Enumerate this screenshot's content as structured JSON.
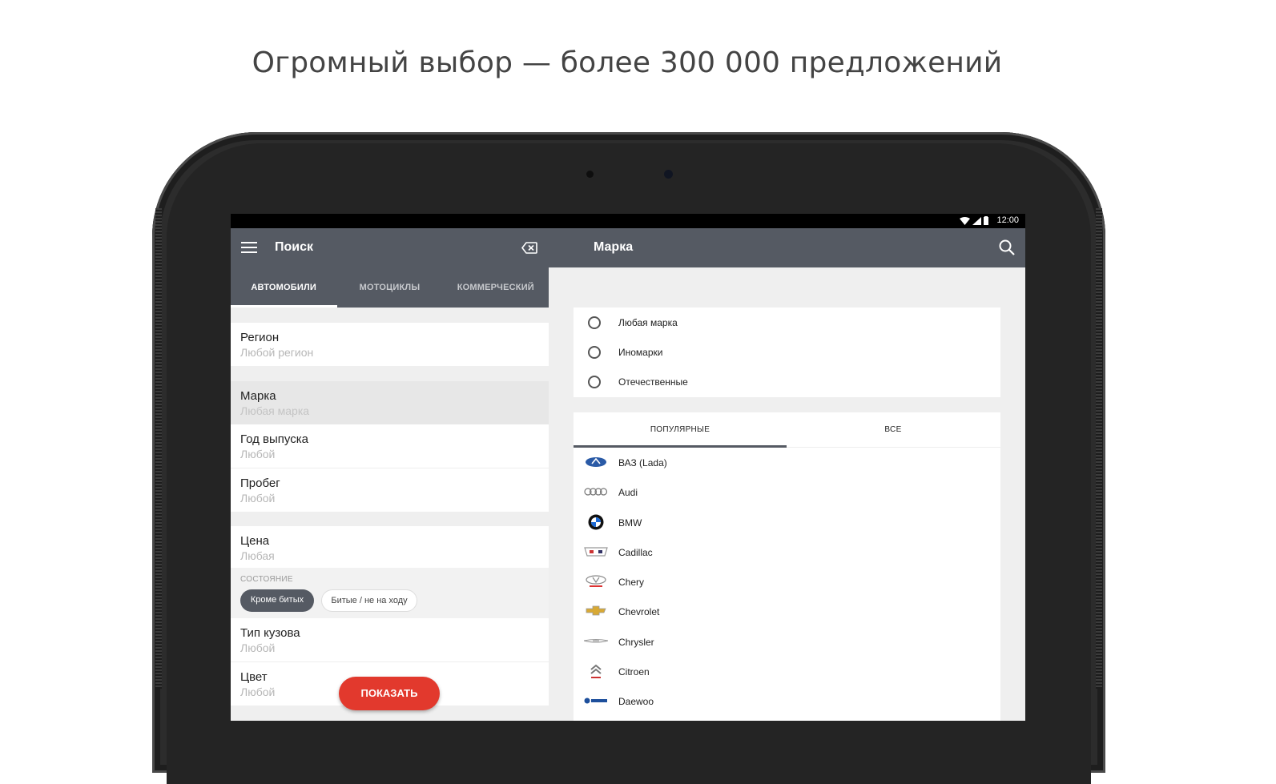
{
  "headline": "Огромный выбор — более 300 000 предложений",
  "statusbar": {
    "time": "12:00"
  },
  "left_panel": {
    "title": "Поиск",
    "tabs": [
      {
        "label": "АВТОМОБИЛИ",
        "active": true
      },
      {
        "label": "МОТОЦИКЛЫ"
      },
      {
        "label": "КОММЕРЧЕСКИЙ"
      }
    ],
    "fields": {
      "region": {
        "label": "Регион",
        "value": "Любой регион"
      },
      "brand": {
        "label": "Марка",
        "value": "Любая марка"
      },
      "year": {
        "label": "Год выпуска",
        "value": "Любой"
      },
      "mileage": {
        "label": "Пробег",
        "value": "Любой"
      },
      "price": {
        "label": "Цена",
        "value": "Любая"
      },
      "body": {
        "label": "Тип кузова",
        "value": "Любой"
      },
      "color": {
        "label": "Цвет",
        "value": "Любой"
      }
    },
    "condition": {
      "caption": "СОСТОЯНИЕ",
      "chips": [
        "Кроме битых",
        "Битые / не на ходу"
      ]
    },
    "show_button": "ПОКАЗАТЬ"
  },
  "right_panel": {
    "title": "Марка",
    "radio_options": [
      "Любая марка",
      "Иномарки",
      "Отечественные"
    ],
    "subtabs": [
      "ПОПУЛЯРНЫЕ",
      "ВСЕ"
    ],
    "brands": [
      "ВАЗ (Lada)",
      "Audi",
      "BMW",
      "Cadillac",
      "Chery",
      "Chevrolet",
      "Chrysler",
      "Citroen",
      "Daewoo"
    ]
  },
  "colors": {
    "toolbar": "#555a63",
    "accent": "#e2392d"
  },
  "icons": [
    "menu-icon",
    "clear-icon",
    "search-icon",
    "wifi-icon",
    "signal-icon",
    "battery-icon"
  ]
}
